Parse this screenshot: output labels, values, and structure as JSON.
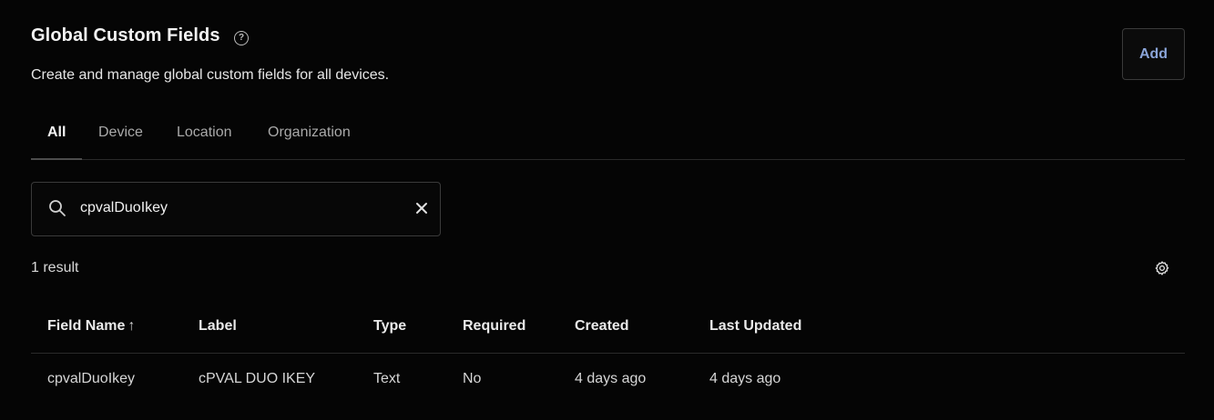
{
  "header": {
    "title": "Global Custom Fields",
    "help_icon": "question-circle-icon",
    "subtitle": "Create and manage global custom fields for all devices.",
    "add_label": "Add"
  },
  "tabs": [
    {
      "label": "All",
      "active": true
    },
    {
      "label": "Device",
      "active": false
    },
    {
      "label": "Location",
      "active": false
    },
    {
      "label": "Organization",
      "active": false
    }
  ],
  "search": {
    "value": "cpvalDuoIkey",
    "search_icon": "search-icon",
    "clear_icon": "close-icon"
  },
  "results": {
    "count_text": "1 result",
    "settings_icon": "gear-icon"
  },
  "table": {
    "columns": [
      "Field Name",
      "Label",
      "Type",
      "Required",
      "Created",
      "Last Updated"
    ],
    "sort_indicator": "↑",
    "rows": [
      {
        "field_name": "cpvalDuoIkey",
        "label": "cPVAL DUO IKEY",
        "type": "Text",
        "required": "No",
        "created": "4 days ago",
        "last_updated": "4 days ago"
      }
    ]
  },
  "colors": {
    "background": "#050505",
    "accent": "#8aa4d8",
    "border": "#3a3a3a"
  }
}
